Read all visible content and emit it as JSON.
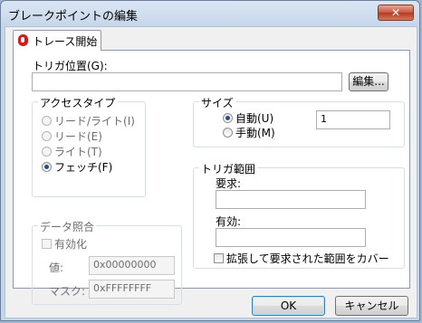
{
  "window": {
    "title": "ブレークポイントの編集",
    "close_symbol": "✕"
  },
  "tab": {
    "label": "トレース開始",
    "icon": "trace-start-icon"
  },
  "location": {
    "label": "トリガ位置(G):",
    "value": "",
    "edit_button": "編集..."
  },
  "access_type": {
    "title": "アクセスタイプ",
    "options": [
      {
        "label": "リード/ライト(I)",
        "checked": false
      },
      {
        "label": "リード(E)",
        "checked": false
      },
      {
        "label": "ライト(T)",
        "checked": false
      },
      {
        "label": "フェッチ(F)",
        "checked": true
      }
    ]
  },
  "size": {
    "title": "サイズ",
    "auto_label": "自動(U)",
    "manual_label": "手動(M)",
    "value": "1",
    "selected": "auto"
  },
  "trigger_range": {
    "title": "トリガ範囲",
    "request_label": "要求:",
    "request_value": "",
    "valid_label": "有効:",
    "valid_value": "",
    "extend_label": "拡張して要求された範囲をカバー"
  },
  "data_match": {
    "title": "データ照合",
    "enable_label": "有効化",
    "value_label": "値:",
    "value_value": "0x00000000",
    "mask_label": "マスク:",
    "mask_value": "0xFFFFFFFF"
  },
  "buttons": {
    "ok": "OK",
    "cancel": "キャンセル"
  }
}
